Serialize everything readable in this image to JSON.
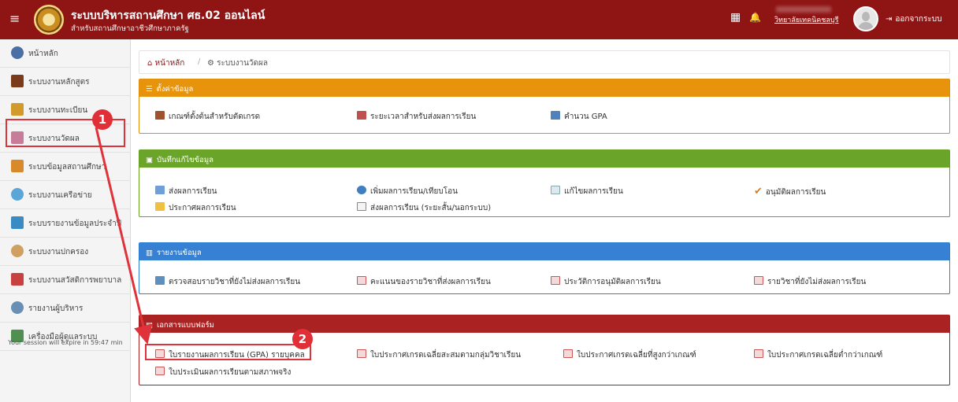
{
  "topbar": {
    "title": "ระบบบริหารสถานศึกษา ศธ.02 ออนไลน์",
    "subtitle": "สำหรับสถานศึกษาอาชีวศึกษาภาครัฐ",
    "calendar_icon": "▦",
    "bell_icon": "🔔",
    "user_label": "วิทยาลัยเทคนิคชลบุรี",
    "logout_label": "ออกจากระบบ",
    "logout_icon": "⇥",
    "menu_icon": "≡"
  },
  "sidebar": {
    "items": [
      {
        "label": "หน้าหลัก",
        "icon": "home-icon",
        "color": "#4a6fa5"
      },
      {
        "label": "ระบบงานหลักสูตร",
        "icon": "book-icon",
        "color": "#7a3b1a"
      },
      {
        "label": "ระบบงานทะเบียน",
        "icon": "users-icon",
        "color": "#d19a2a"
      },
      {
        "label": "ระบบงานวัดผล",
        "icon": "report-icon",
        "color": "#c77d9a"
      },
      {
        "label": "ระบบข้อมูลสถานศึกษา",
        "icon": "school-icon",
        "color": "#d8892a"
      },
      {
        "label": "ระบบงานเครือข่าย",
        "icon": "cloud-icon",
        "color": "#5aa6d6"
      },
      {
        "label": "ระบบรายงานข้อมูลประจำปี",
        "icon": "chart-icon",
        "color": "#3a8bc4"
      },
      {
        "label": "ระบบงานปกครอง",
        "icon": "person-icon",
        "color": "#d0a060"
      },
      {
        "label": "ระบบงานสวัสดิการพยาบาล",
        "icon": "medkit-icon",
        "color": "#c94040"
      },
      {
        "label": "รายงานผู้บริหาร",
        "icon": "director-icon",
        "color": "#6a8fb5"
      },
      {
        "label": "เครื่องมือผู้ดูแลระบบ",
        "icon": "admin-icon",
        "color": "#4f8f4f"
      }
    ],
    "session_text": "Your session will expire in 59:47 min"
  },
  "breadcrumb": {
    "home": "หน้าหลัก",
    "separator": "/",
    "current": "ระบบงานวัดผล",
    "home_icon": "⌂",
    "current_icon": "⚙"
  },
  "panels": {
    "settings": {
      "title": "ตั้งค่าข้อมูล",
      "title_icon": "☰",
      "links": [
        "เกณฑ์ตั้งต้นสำหรับตัดเกรด",
        "ระยะเวลาสำหรับส่งผลการเรียน",
        "คำนวน GPA"
      ]
    },
    "records": {
      "title": "บันทึกแก้ไขข้อมูล",
      "title_icon": "▣",
      "links": [
        "ส่งผลการเรียน",
        "เพิ่มผลการเรียน/เทียบโอน",
        "แก้ไขผลการเรียน",
        "อนุมัติผลการเรียน",
        "ประกาศผลการเรียน",
        "ส่งผลการเรียน (ระยะสั้น/นอกระบบ)"
      ]
    },
    "reports": {
      "title": "รายงานข้อมูล",
      "title_icon": "▥",
      "links": [
        "ตรวจสอบรายวิชาที่ยังไม่ส่งผลการเรียน",
        "คะแนนของรายวิชาที่ส่งผลการเรียน",
        "ประวัติการอนุมัติผลการเรียน",
        "รายวิชาที่ยังไม่ส่งผลการเรียน"
      ]
    },
    "documents": {
      "title": "เอกสารแบบฟอร์ม",
      "title_icon": "▤",
      "links": [
        "ใบรายงานผลการเรียน (GPA) รายบุคคล",
        "ใบประกาศเกรดเฉลี่ยสะสมตามกลุ่มวิชาเรียน",
        "ใบประกาศเกรดเฉลี่ยที่สูงกว่าเกณฑ์",
        "ใบประกาศเกรดเฉลี่ยต่ำกว่าเกณฑ์",
        "ใบประเมินผลการเรียนตามสภาพจริง"
      ]
    }
  },
  "annotations": {
    "badge1": "1",
    "badge2": "2",
    "color": "#e0323a"
  }
}
